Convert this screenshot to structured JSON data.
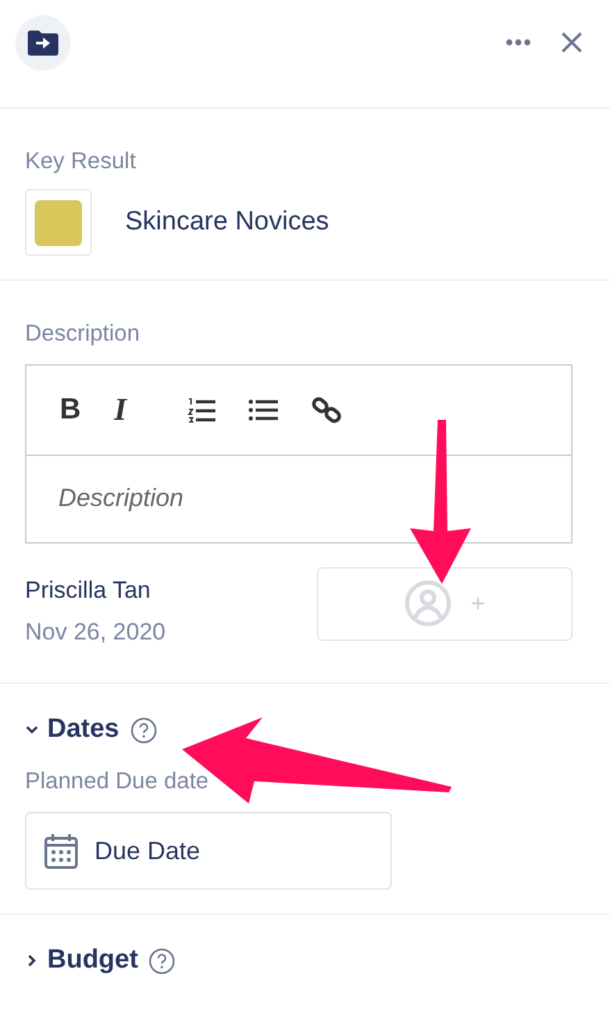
{
  "header": {
    "actions": [
      {
        "kind": "more"
      },
      {
        "kind": "close"
      }
    ]
  },
  "key_result": {
    "label": "Key Result",
    "color": "#d9c75c",
    "title": "Skincare Novices"
  },
  "description": {
    "label": "Description",
    "toolbar": [
      {
        "kind": "bold",
        "glyph": "B"
      },
      {
        "kind": "italic",
        "glyph": "I"
      },
      {
        "kind": "ordered-list"
      },
      {
        "kind": "bullet-list"
      },
      {
        "kind": "link"
      }
    ],
    "placeholder": "Description"
  },
  "owner": {
    "name": "Priscilla Tan",
    "date": "Nov 26, 2020",
    "assign_label": "+"
  },
  "sections": [
    {
      "title": "Dates",
      "expanded": true,
      "fields": [
        {
          "label": "Planned Due date",
          "placeholder": "Due Date"
        }
      ]
    },
    {
      "title": "Budget",
      "expanded": false
    }
  ],
  "annotations": [
    {
      "kind": "arrow-down"
    },
    {
      "kind": "arrow-left"
    }
  ]
}
